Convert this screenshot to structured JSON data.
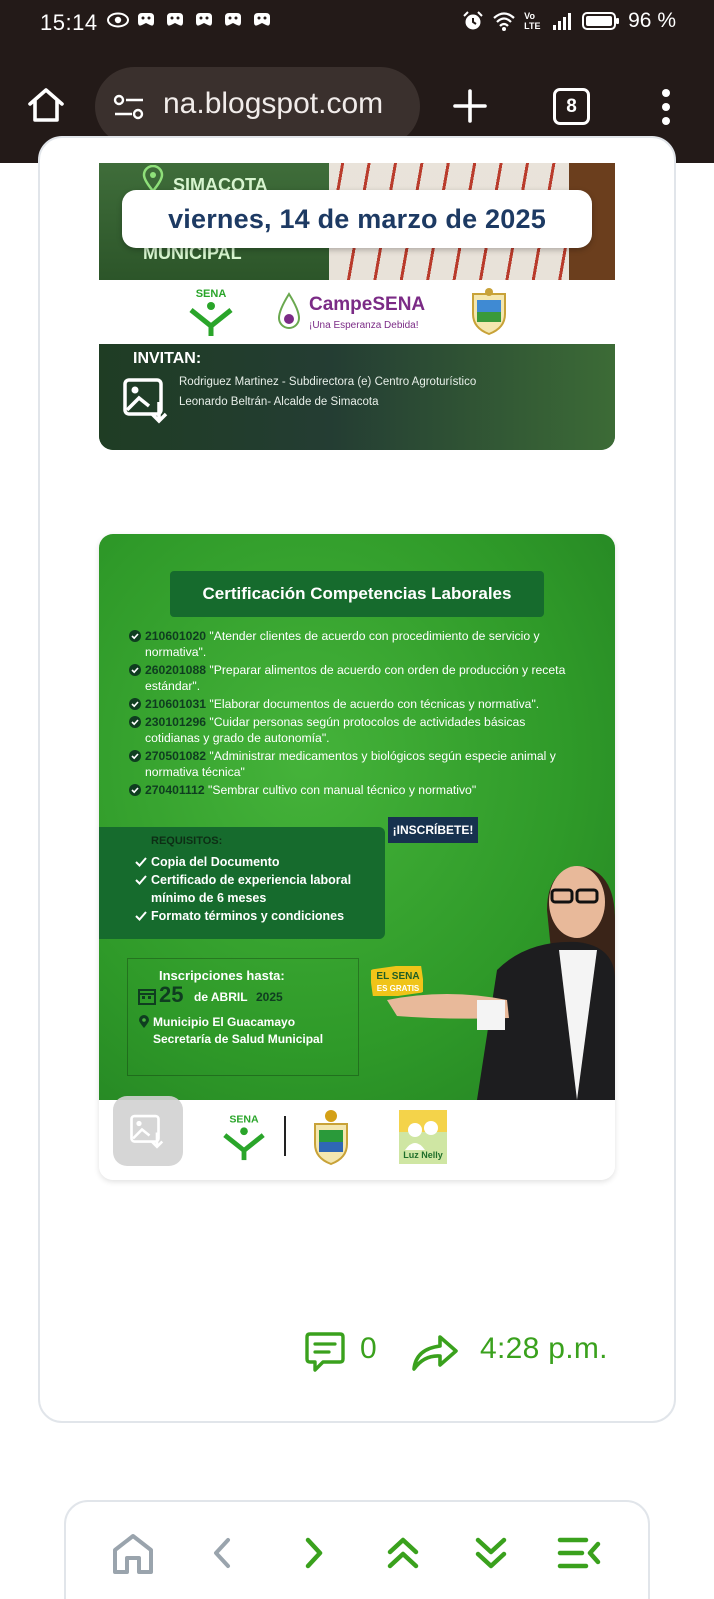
{
  "status_bar": {
    "time": "15:14",
    "lte_label": "Vo\nLTE",
    "battery": "96 %"
  },
  "browser": {
    "url": "na.blogspot.com",
    "tab_count": "8"
  },
  "post": {
    "date": "viernes, 14 de marzo de 2025",
    "image1": {
      "location": "SIMACOTA",
      "municipal": "MUNICIPAL",
      "brand": "CampeSENA",
      "brand_tagline": "¡Una Esperanza Debida!",
      "sena_label": "SENA",
      "invitan": "INVITAN:",
      "line1": "Rodriguez Martinez - Subdirectora (e) Centro Agroturístico",
      "line2": "Leonardo Beltrán- Alcalde de Simacota"
    },
    "image2": {
      "title": "Certificación Competencias Laborales",
      "competencies": [
        {
          "code": "210601020",
          "text": " \"Atender clientes de acuerdo con procedimiento de servicio y normativa\"."
        },
        {
          "code": "260201088",
          "text": " \"Preparar alimentos de acuerdo con orden de producción y receta estándar\"."
        },
        {
          "code": "210601031",
          "text": " \"Elaborar documentos de acuerdo con técnicas y normativa\"."
        },
        {
          "code": "230101296",
          "text": " \"Cuidar personas según protocolos de actividades básicas cotidianas y grado de autonomía\"."
        },
        {
          "code": "270501082",
          "text": " \"Administrar medicamentos y biológicos según especie animal y normativa técnica\""
        },
        {
          "code": "270401112",
          "text": " \"Sembrar cultivo con manual técnico y normativo\""
        }
      ],
      "inscribete": "¡INSCRÍBETE!",
      "requisitos_title": "REQUISITOS:",
      "requisitos": [
        "Copia del Documento",
        "Certificado de experiencia  laboral mínimo de 6 meses",
        "Formato términos y condiciones"
      ],
      "inscripciones_hasta": "Inscripciones hasta:",
      "day": "25",
      "month": "de ABRIL",
      "year": "2025",
      "municipio": "Municipio El Guacamayo",
      "secretaria": "Secretaría de Salud Municipal",
      "badge_top": "EL SENA",
      "badge_bottom": "ES GRATIS",
      "sena_label": "SENA",
      "luz_label": "Luz Nelly"
    },
    "comments": "0",
    "time": "4:28 p.m."
  },
  "colors": {
    "accent_green": "#3aa11d",
    "date_text": "#1d3a63",
    "top_bar": "#231a18"
  },
  "icons": [
    "home-icon",
    "tune-icon",
    "plus-icon",
    "tabs-icon",
    "more-icon",
    "image-download-icon",
    "comment-icon",
    "share-icon",
    "chevron-left-icon",
    "chevron-right-icon",
    "double-chevron-up-icon",
    "double-chevron-down-icon",
    "menu-collapse-icon"
  ]
}
